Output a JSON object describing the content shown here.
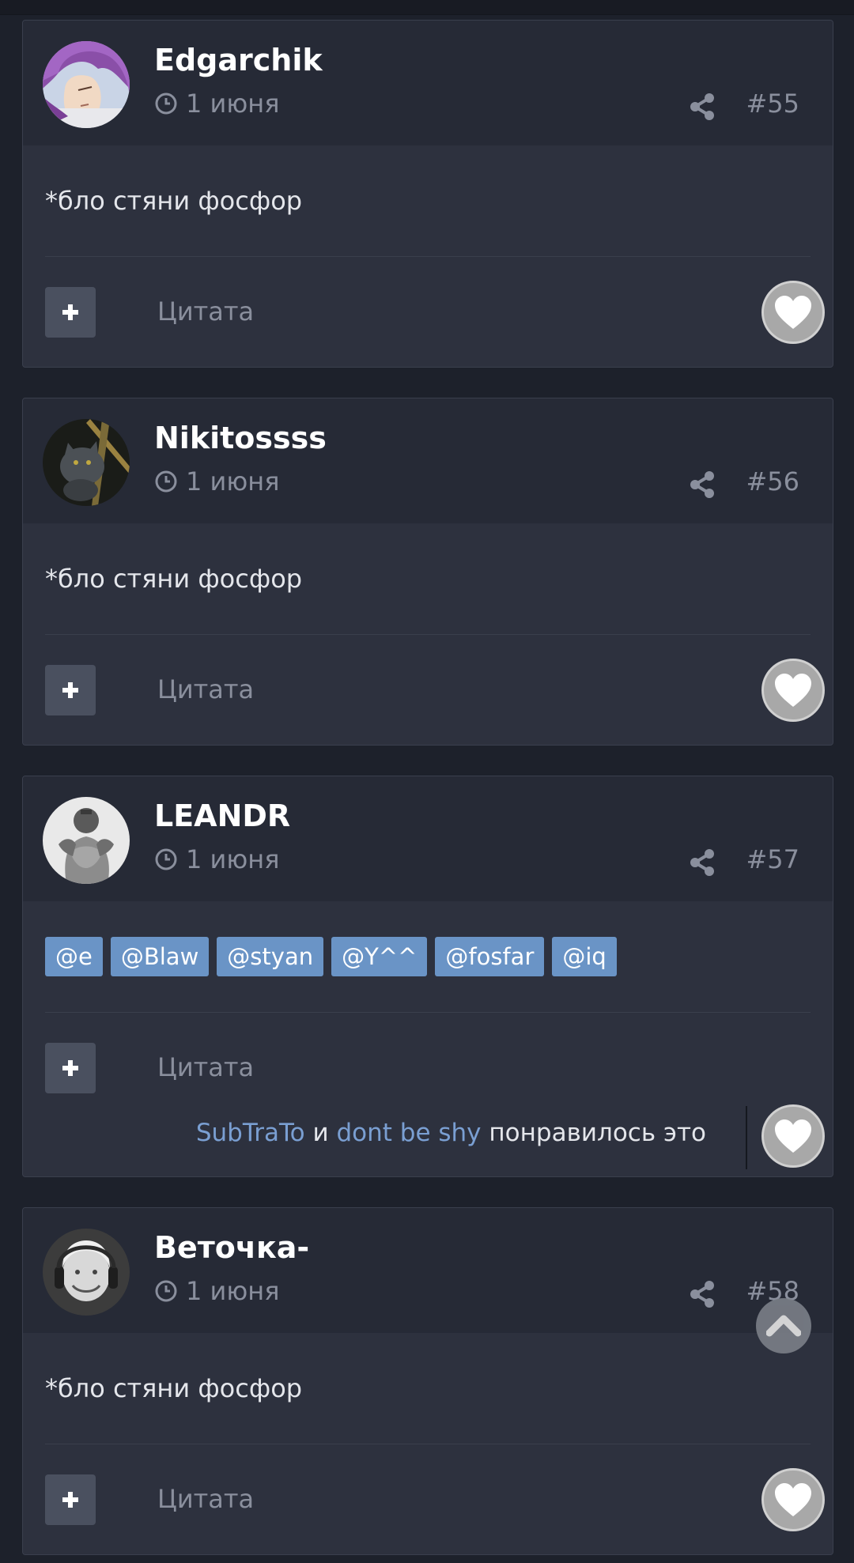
{
  "quote_label": "Цитата",
  "posts": [
    {
      "username": "Edgarchik",
      "date": "1 июня",
      "number": "#55",
      "text": "*бло стяни фосфор",
      "avatar": "purple-hair-anime-avatar"
    },
    {
      "username": "Nikitossss",
      "date": "1 июня",
      "number": "#56",
      "text": "*бло стяни фосфор",
      "avatar": "dark-cat-avatar"
    },
    {
      "username": "LEANDR",
      "date": "1 июня",
      "number": "#57",
      "mentions": [
        "@e",
        "@Blaw",
        "@styan",
        "@Y^^",
        "@fosfar",
        "@iq"
      ],
      "likes": {
        "user1": "SubTraTo",
        "conj": "и",
        "user2": "dont be shy",
        "suffix": "понравилось это"
      },
      "avatar": "bw-man-photo-avatar"
    },
    {
      "username": "Веточка-",
      "date": "1 июня",
      "number": "#58",
      "text": "*бло стяни фосфор",
      "avatar": "bw-headphones-man-avatar"
    }
  ],
  "colors": {
    "page_bg": "#1d212b",
    "card_bg": "#2d313e",
    "header_bg": "#262a36",
    "mention_bg": "#6a94c6",
    "link": "#7a9fd2",
    "muted": "#8a8f9d"
  },
  "icons": {
    "clock": "clock-icon",
    "share": "share-icon",
    "plus": "plus-icon",
    "heart": "heart-icon",
    "scroll_top": "chevron-up-icon"
  }
}
